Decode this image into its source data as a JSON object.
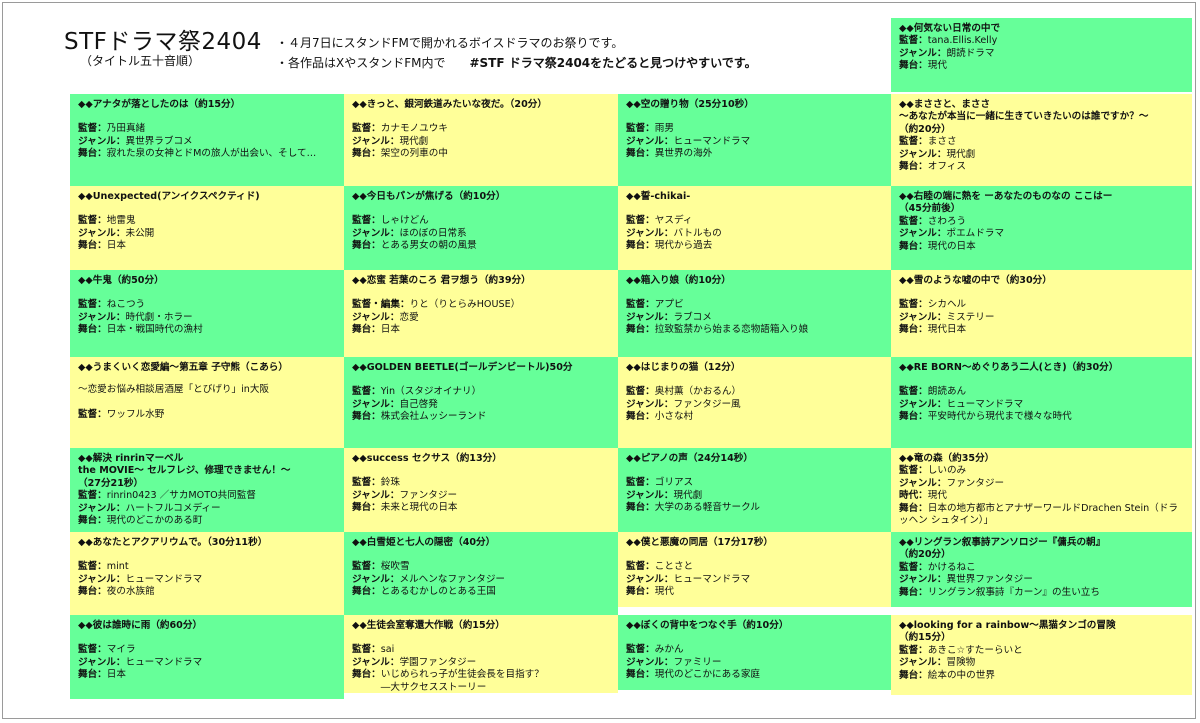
{
  "header": {
    "title": "STFドラマ祭2404",
    "subtitle": "（タイトル五十音順）",
    "note1": "・４月7日にスタンドFMで開かれるボイスドラマのお祭りです。",
    "note2": "・各作品はXやスタンドFM内で",
    "hashtag": "#STF ドラマ祭2404をたどると見つけやすいです。"
  },
  "cards": [
    {
      "col": 0,
      "row": 0,
      "color": "green",
      "title": "◆◆アナタが落としたのは（約15分）",
      "rows": [
        [
          "監督：",
          "乃田真緒"
        ],
        [
          "ジャンル：",
          "異世界ラブコメ"
        ],
        [
          "舞台：",
          "寂れた泉の女神とドMの旅人が出会い、そして…"
        ]
      ]
    },
    {
      "col": 1,
      "row": 0,
      "color": "yellow",
      "title": "◆◆きっと、銀河鉄道みたいな夜だ。（20分）",
      "rows": [
        [
          "監督：",
          "カナモノユウキ"
        ],
        [
          "ジャンル：",
          "現代劇"
        ],
        [
          "舞台：",
          "架空の列車の中"
        ]
      ]
    },
    {
      "col": 2,
      "row": 0,
      "color": "green",
      "title": "◆◆空の贈り物（25分10秒）",
      "rows": [
        [
          "監督：",
          "雨男"
        ],
        [
          "ジャンル：",
          "ヒューマンドラマ"
        ],
        [
          "舞台：",
          "異世界の海外"
        ]
      ]
    },
    {
      "col": 3,
      "row": -1,
      "color": "green",
      "title": "◆◆何気ない日常の中で",
      "rows": [
        [
          "監督：",
          "tana.Ellis.Kelly"
        ],
        [
          "ジャンル：",
          "朗読ドラマ"
        ],
        [
          "舞台：",
          "現代"
        ]
      ],
      "compact": true
    },
    {
      "col": 3,
      "row": 0,
      "color": "yellow",
      "title": "◆◆まささと、まささ\n～あなたが本当に一緒に生きていきたいのは誰ですか？～\n（約20分）",
      "rows": [
        [
          "監督：",
          "まささ"
        ],
        [
          "ジャンル：",
          "現代劇"
        ],
        [
          "舞台：",
          "オフィス"
        ]
      ],
      "compact": true
    },
    {
      "col": 0,
      "row": 1,
      "color": "yellow",
      "title": "◆◆Unexpected(アンイクスペクティド)",
      "rows": [
        [
          "監督：",
          "地雷鬼"
        ],
        [
          "ジャンル：",
          "未公開"
        ],
        [
          "舞台：",
          "日本"
        ]
      ]
    },
    {
      "col": 1,
      "row": 1,
      "color": "green",
      "title": "◆◆今日もパンが焦げる（約10分）",
      "rows": [
        [
          "監督：",
          "しゃけどん"
        ],
        [
          "ジャンル：",
          "ほのぼの日常系"
        ],
        [
          "舞台：",
          "とある男女の朝の風景"
        ]
      ]
    },
    {
      "col": 2,
      "row": 1,
      "color": "yellow",
      "title": "◆◆誓-chikai-",
      "rows": [
        [
          "監督：",
          "ヤスディ"
        ],
        [
          "ジャンル：",
          "バトルもの"
        ],
        [
          "舞台：",
          "現代から過去"
        ]
      ]
    },
    {
      "col": 3,
      "row": 1,
      "color": "green",
      "title": "◆◆右睦の端に熱を ーあなたのものなの ここはー\n（45分前後）",
      "rows": [
        [
          "監督：",
          "さわろう"
        ],
        [
          "ジャンル：",
          "ポエムドラマ"
        ],
        [
          "舞台：",
          "現代の日本"
        ]
      ],
      "compact": true
    },
    {
      "col": 0,
      "row": 2,
      "color": "green",
      "title": "◆◆牛鬼（約50分）",
      "rows": [
        [
          "監督：",
          "ねこつう"
        ],
        [
          "ジャンル：",
          "時代劇・ホラー"
        ],
        [
          "舞台：",
          "日本・戦国時代の漁村"
        ]
      ]
    },
    {
      "col": 1,
      "row": 2,
      "color": "yellow",
      "title": "◆◆恋蜜 若葉のころ 君ヲ想う（約39分）",
      "rows": [
        [
          "監督・編集：",
          "りと（りとらみHOUSE）"
        ],
        [
          "ジャンル：",
          "恋愛"
        ],
        [
          "舞台：",
          "日本"
        ]
      ]
    },
    {
      "col": 2,
      "row": 2,
      "color": "green",
      "title": "◆◆箱入り娘（約10分）",
      "rows": [
        [
          "監督：",
          "アプビ"
        ],
        [
          "ジャンル：",
          "ラブコメ"
        ],
        [
          "舞台：",
          "拉致監禁から始まる恋物語箱入り娘"
        ]
      ]
    },
    {
      "col": 3,
      "row": 2,
      "color": "yellow",
      "title": "◆◆雪のような嘘の中で（約30分）",
      "rows": [
        [
          "監督：",
          "シカヘル"
        ],
        [
          "ジャンル：",
          "ミステリー"
        ],
        [
          "舞台：",
          "現代日本"
        ]
      ]
    },
    {
      "col": 0,
      "row": 3,
      "color": "yellow",
      "title": "◆◆うまくいく恋愛編～第五章 子守熊（こあら）",
      "desc": "～恋愛お悩み相談居酒屋「とびげり」in大阪",
      "rows": [
        [
          "監督：",
          "ワッフル水野"
        ]
      ]
    },
    {
      "col": 1,
      "row": 3,
      "color": "green",
      "title": "◆◆GOLDEN BEETLE(ゴールデンビートル)50分",
      "rows": [
        [
          "監督：",
          "Yin（スタジオイナリ）"
        ],
        [
          "ジャンル：",
          "自己啓発"
        ],
        [
          "舞台：",
          "株式会社ムッシーランド"
        ]
      ]
    },
    {
      "col": 2,
      "row": 3,
      "color": "yellow",
      "title": "◆◆はじまりの猫（12分）",
      "rows": [
        [
          "監督：",
          "奥村薫（かおるん）"
        ],
        [
          "ジャンル：",
          "ファンタジー風"
        ],
        [
          "舞台：",
          "小さな村"
        ]
      ]
    },
    {
      "col": 3,
      "row": 3,
      "color": "green",
      "title": "◆◆RE BORN～めぐりあう二人(とき)（約30分）",
      "rows": [
        [
          "監督：",
          "朗読あん"
        ],
        [
          "ジャンル：",
          "ヒューマンドラマ"
        ],
        [
          "舞台：",
          "平安時代から現代まで様々な時代"
        ]
      ]
    },
    {
      "col": 0,
      "row": 4,
      "color": "green",
      "title": "◆◆解決 rinrinマーベル\nthe MOVIE～ セルフレジ、修理できません！～\n（27分21秒）",
      "rows": [
        [
          "監督：",
          "rinrin0423 ／サカMOTO共同監督"
        ],
        [
          "ジャンル：",
          "ハートフルコメディー"
        ],
        [
          "舞台：",
          "現代のどこかのある町"
        ]
      ],
      "compact": true
    },
    {
      "col": 1,
      "row": 4,
      "color": "yellow",
      "title": "◆◆success セクサス（約13分）",
      "rows": [
        [
          "監督：",
          "鈴珠"
        ],
        [
          "ジャンル：",
          "ファンタジー"
        ],
        [
          "舞台：",
          "未来と現代の日本"
        ]
      ]
    },
    {
      "col": 2,
      "row": 4,
      "color": "green",
      "title": "◆◆ピアノの声（24分14秒）",
      "rows": [
        [
          "監督：",
          "ゴリアス"
        ],
        [
          "ジャンル：",
          "現代劇"
        ],
        [
          "舞台：",
          "大学のある軽音サークル"
        ]
      ]
    },
    {
      "col": 3,
      "row": 4,
      "color": "yellow",
      "title": "◆◆竜の森（約35分）",
      "rows": [
        [
          "監督：",
          "しいのみ"
        ],
        [
          "ジャンル：",
          "ファンタジー"
        ],
        [
          "時代：",
          "現代"
        ],
        [
          "舞台：",
          "日本の地方都市とアナザーワールドDrachen Stein（ドラッヘン シュタイン）」"
        ]
      ],
      "compact": true
    },
    {
      "col": 0,
      "row": 5,
      "color": "yellow",
      "title": "◆◆あなたとアクアリウムで。（30分11秒）",
      "rows": [
        [
          "監督：",
          "mint"
        ],
        [
          "ジャンル：",
          "ヒューマンドラマ"
        ],
        [
          "舞台：",
          "夜の水族館"
        ]
      ]
    },
    {
      "col": 1,
      "row": 5,
      "color": "green",
      "title": "◆◆白雪姫と七人の隠密（40分）",
      "rows": [
        [
          "監督：",
          "桜吹雪"
        ],
        [
          "ジャンル：",
          "メルヘンなファンタジー"
        ],
        [
          "舞台：",
          "とあるむかしのとある王国"
        ]
      ]
    },
    {
      "col": 2,
      "row": 5,
      "color": "yellow",
      "title": "◆◆僕と悪魔の同居（17分17秒）",
      "rows": [
        [
          "監督：",
          "ことさと"
        ],
        [
          "ジャンル：",
          "ヒューマンドラマ"
        ],
        [
          "舞台：",
          "現代"
        ]
      ]
    },
    {
      "col": 3,
      "row": 5,
      "color": "green",
      "title": "◆◆リングラン叙事詩アンソロジー『傭兵の朝』\n（約20分）",
      "rows": [
        [
          "監督：",
          "かけるねこ"
        ],
        [
          "ジャンル：",
          "異世界ファンタジー"
        ],
        [
          "舞台：",
          "リングラン叙事詩『カーン』の生い立ち"
        ]
      ],
      "compact": true
    },
    {
      "col": 0,
      "row": 6,
      "color": "green",
      "title": "◆◆彼は誰時に雨（約60分）",
      "rows": [
        [
          "監督：",
          "マイラ"
        ],
        [
          "ジャンル：",
          "ヒューマンドラマ"
        ],
        [
          "舞台：",
          "日本"
        ]
      ]
    },
    {
      "col": 1,
      "row": 6,
      "color": "yellow",
      "title": "◆◆生徒会室奪還大作戦（約15分）",
      "rows": [
        [
          "監督：",
          "sai"
        ],
        [
          "ジャンル：",
          "学園ファンタジー"
        ],
        [
          "舞台：",
          "いじめられっ子が生徒会長を目指す？\n　　　―大サクセスストーリー"
        ]
      ]
    },
    {
      "col": 2,
      "row": 6,
      "color": "green",
      "title": "◆◆ぼくの背中をつなぐ手（約10分）",
      "rows": [
        [
          "監督：",
          "みかん"
        ],
        [
          "ジャンル：",
          "ファミリー"
        ],
        [
          "舞台：",
          "現代のどこかにある家庭"
        ]
      ]
    },
    {
      "col": 3,
      "row": 6,
      "color": "yellow",
      "title": "◆◆looking for a rainbow～黒猫タンゴの冒険\n（約15分）",
      "rows": [
        [
          "監督：",
          "あきこ☆すたーらいと"
        ],
        [
          "ジャンル：",
          "冒険物"
        ],
        [
          "舞台：",
          "絵本の中の世界"
        ]
      ],
      "compact": true
    }
  ]
}
